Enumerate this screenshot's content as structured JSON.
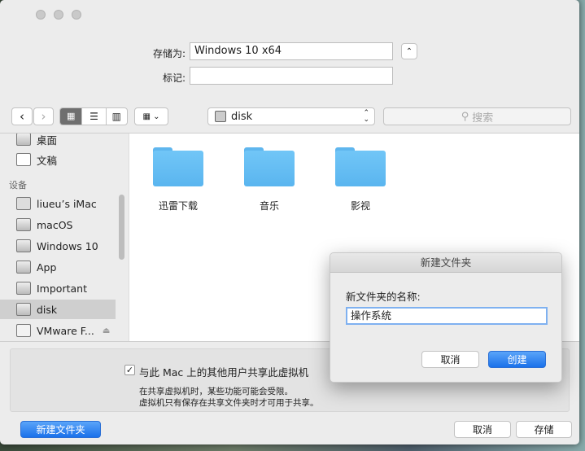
{
  "save_as": {
    "label": "存储为:",
    "value": "Windows 10 x64"
  },
  "tags": {
    "label": "标记:",
    "value": ""
  },
  "toolbar": {
    "path": "disk",
    "search_placeholder": "搜索"
  },
  "sidebar": {
    "items_top": [
      {
        "label": "桌面",
        "icon": "desktop-icon"
      },
      {
        "label": "文稿",
        "icon": "document-icon"
      }
    ],
    "section": "设备",
    "devices": [
      {
        "label": "liueu’s iMac",
        "icon": "imac-icon"
      },
      {
        "label": "macOS",
        "icon": "disk-icon"
      },
      {
        "label": "Windows 10",
        "icon": "disk-icon"
      },
      {
        "label": "App",
        "icon": "disk-icon"
      },
      {
        "label": "Important",
        "icon": "disk-icon"
      },
      {
        "label": "disk",
        "icon": "disk-icon",
        "selected": true
      },
      {
        "label": "VMware F...",
        "icon": "external-disk-icon"
      }
    ]
  },
  "files": [
    {
      "name": "迅雷下载"
    },
    {
      "name": "音乐"
    },
    {
      "name": "影视"
    }
  ],
  "share": {
    "checked": true,
    "label": "与此 Mac 上的其他用户共享此虚拟机",
    "note1": "在共享虚拟机时，某些功能可能会受限。",
    "note2": "虚拟机只有保存在共享文件夹时才可用于共享。"
  },
  "buttons": {
    "new_folder": "新建文件夹",
    "cancel": "取消",
    "save": "存储"
  },
  "dialog": {
    "title": "新建文件夹",
    "label": "新文件夹的名称:",
    "value": "操作系统",
    "cancel": "取消",
    "create": "创建"
  }
}
